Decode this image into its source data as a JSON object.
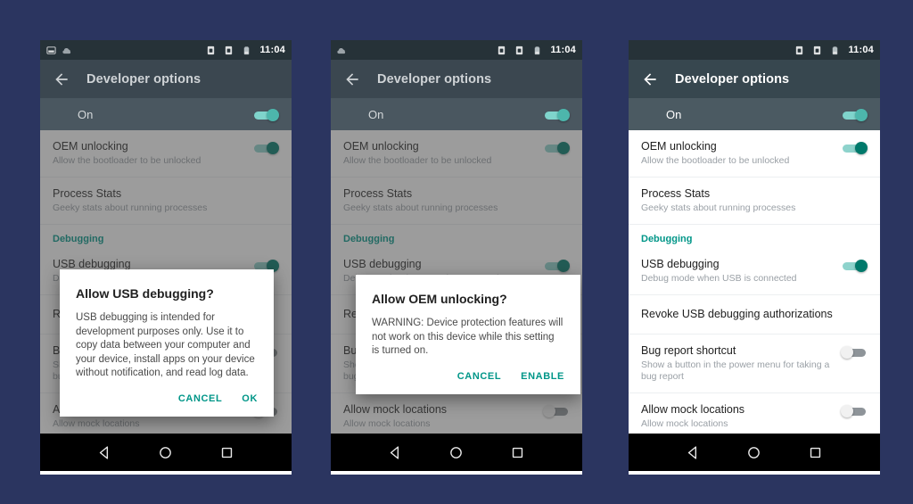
{
  "background_color": "#2b3560",
  "status_bar": {
    "left_icons": [
      "screenshot-icon",
      "cloud-icon"
    ],
    "right_icons": [
      "sim-card-1-icon",
      "sim-card-2-icon",
      "battery-icon"
    ],
    "time": "11:04"
  },
  "app_bar": {
    "back_label": "back-arrow-icon",
    "title": "Developer options"
  },
  "master_toggle": {
    "label": "On",
    "state": "on"
  },
  "nav_bar": {
    "back": "back-triangle-icon",
    "home": "home-circle-icon",
    "recents": "recents-square-icon"
  },
  "colors": {
    "accent_teal": "#009688",
    "toggle_on_track": "#8ed3cc",
    "toggle_on_thumb": "#00796b",
    "toggle_off_track": "#8e9499",
    "toggle_off_thumb": "#f1f1f1",
    "app_bar": "#37474f",
    "status_bar": "#263238",
    "master_row": "#4b5a62"
  },
  "settings_list": [
    {
      "id": "oem-unlocking",
      "title": "OEM unlocking",
      "subtitle": "Allow the bootloader to be unlocked",
      "control": "toggle",
      "state": "on"
    },
    {
      "id": "process-stats",
      "title": "Process Stats",
      "subtitle": "Geeky stats about running processes",
      "control": "none",
      "state": ""
    },
    {
      "id": "debugging-header",
      "title": "Debugging",
      "subtitle": "",
      "control": "section",
      "state": ""
    },
    {
      "id": "usb-debugging",
      "title": "USB debugging",
      "subtitle": "Debug mode when USB is connected",
      "control": "toggle",
      "state": "on"
    },
    {
      "id": "revoke-usb-debugging-authorizations",
      "title": "Revoke USB debugging authorizations",
      "subtitle": "",
      "control": "none",
      "state": ""
    },
    {
      "id": "bug-report-shortcut",
      "title": "Bug report shortcut",
      "subtitle": "Show a button in the power menu for taking a bug report",
      "control": "toggle",
      "state": "off"
    },
    {
      "id": "allow-mock-locations",
      "title": "Allow mock locations",
      "subtitle": "Allow mock locations",
      "control": "toggle",
      "state": "off"
    }
  ],
  "panels": [
    {
      "id": "panel-usb-debugging",
      "dialog": {
        "title": "Allow USB debugging?",
        "body": "USB debugging is intended for development purposes only. Use it to copy data between your computer and your device, install apps on your device without notification, and read log data.",
        "buttons": [
          "CANCEL",
          "OK"
        ]
      }
    },
    {
      "id": "panel-oem-unlocking",
      "dialog": {
        "title": "Allow OEM unlocking?",
        "body": "WARNING: Device protection features will not work on this device while this setting is turned on.",
        "buttons": [
          "CANCEL",
          "ENABLE"
        ]
      }
    },
    {
      "id": "panel-developer-options-list",
      "dialog": null
    }
  ]
}
